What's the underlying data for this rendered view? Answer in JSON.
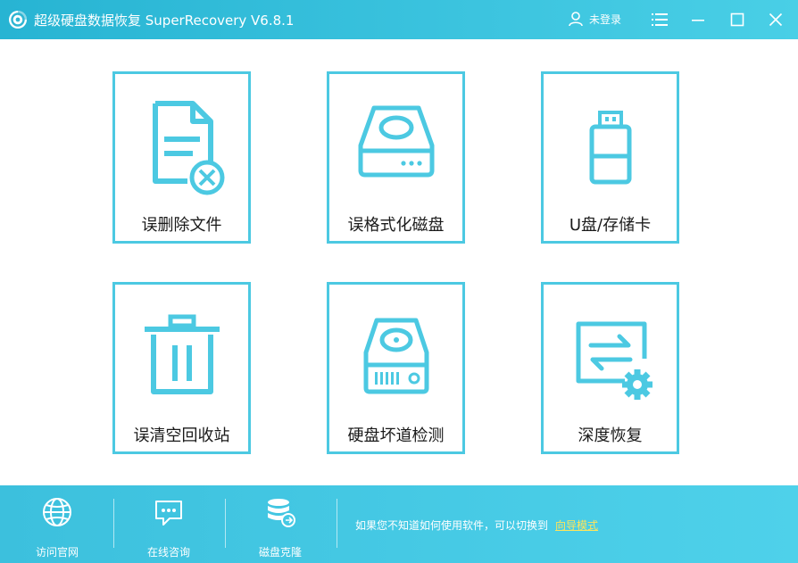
{
  "window": {
    "title": "超级硬盘数据恢复 SuperRecovery V6.8.1",
    "login_label": "未登录"
  },
  "cards": [
    {
      "label": "误删除文件",
      "icon": "deleted-file-icon"
    },
    {
      "label": "误格式化磁盘",
      "icon": "hard-drive-icon"
    },
    {
      "label": "U盘/存储卡",
      "icon": "usb-drive-icon"
    },
    {
      "label": "误清空回收站",
      "icon": "trash-bin-icon"
    },
    {
      "label": "硬盘坏道检测",
      "icon": "hdd-scan-icon"
    },
    {
      "label": "深度恢复",
      "icon": "deep-recovery-icon"
    }
  ],
  "footer": {
    "buttons": [
      {
        "label": "访问官网",
        "icon": "globe-icon"
      },
      {
        "label": "在线咨询",
        "icon": "chat-icon"
      },
      {
        "label": "磁盘克隆",
        "icon": "database-icon"
      }
    ],
    "hint_text": "如果您不知道如何使用软件，可以切换到",
    "hint_link": "向导模式"
  },
  "colors": {
    "accent": "#4cc9e2",
    "title_bar": "#3cc4df",
    "link": "#ffe55a"
  }
}
